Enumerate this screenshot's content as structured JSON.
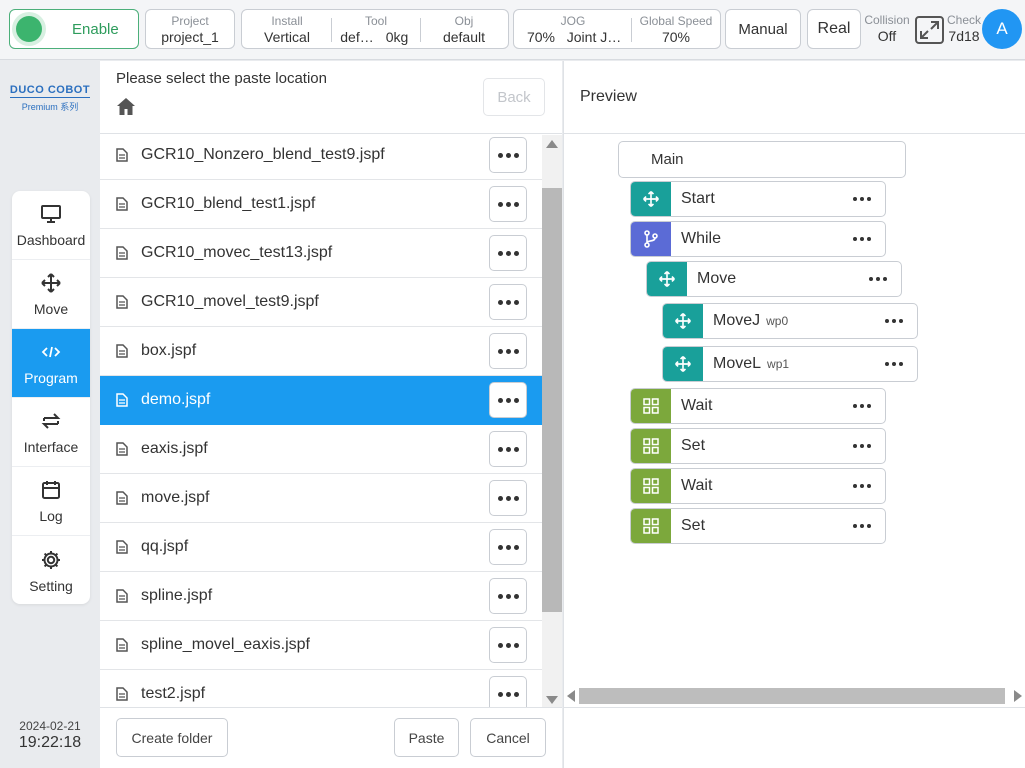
{
  "topbar": {
    "enable_label": "Enable",
    "project": {
      "caption": "Project",
      "value": "project_1"
    },
    "install": {
      "caption": "Install",
      "value": "Vertical"
    },
    "tool": {
      "caption": "Tool",
      "name": "def…",
      "weight": "0kg"
    },
    "obj": {
      "caption": "Obj",
      "value": "default"
    },
    "jog": {
      "caption": "JOG",
      "percent": "70%",
      "mode": "Joint J…"
    },
    "global_speed": {
      "caption": "Global Speed",
      "value": "70%"
    },
    "manual_label": "Manual",
    "real_label": "Real",
    "collision": {
      "caption": "Collision",
      "value": "Off"
    },
    "check": {
      "caption": "Check",
      "value": "7d18"
    },
    "avatar_letter": "A",
    "colors": {
      "enable_green": "#3cb46e",
      "accent_blue": "#1a9bf0",
      "avatar_blue": "#2196f3"
    }
  },
  "brand": {
    "line1": "DUCO COBOT",
    "line2": "Premium 系列"
  },
  "nav": {
    "items": [
      {
        "label": "Dashboard",
        "icon": "monitor-icon"
      },
      {
        "label": "Move",
        "icon": "move-arrows-icon"
      },
      {
        "label": "Program",
        "icon": "code-icon",
        "active": true
      },
      {
        "label": "Interface",
        "icon": "swap-icon"
      },
      {
        "label": "Log",
        "icon": "calendar-icon"
      },
      {
        "label": "Setting",
        "icon": "gear-icon"
      }
    ]
  },
  "datetime": {
    "date": "2024-02-21",
    "time": "19:22:18"
  },
  "filepanel": {
    "title": "Please select the paste location",
    "back_label": "Back",
    "files": [
      "GCR10_Nonzero_blend_test9.jspf",
      "GCR10_blend_test1.jspf",
      "GCR10_movec_test13.jspf",
      "GCR10_movel_test9.jspf",
      "box.jspf",
      "demo.jspf",
      "eaxis.jspf",
      "move.jspf",
      "qq.jspf",
      "spline.jspf",
      "spline_movel_eaxis.jspf",
      "test2.jspf"
    ],
    "selected": "demo.jspf",
    "footer": {
      "create_folder": "Create folder",
      "paste": "Paste",
      "cancel": "Cancel"
    }
  },
  "preview": {
    "title": "Preview",
    "main_label": "Main",
    "nodes": [
      {
        "label": "Start",
        "icon": "move-arrows-icon",
        "color": "#19a09a"
      },
      {
        "label": "While",
        "icon": "branch-icon",
        "color": "#5b6bd6"
      },
      {
        "label": "Move",
        "icon": "move-arrows-icon",
        "color": "#19a09a"
      },
      {
        "label": "MoveJ",
        "sub": "wp0",
        "icon": "move-arrows-icon",
        "color": "#19a09a"
      },
      {
        "label": "MoveL",
        "sub": "wp1",
        "icon": "move-arrows-icon",
        "color": "#19a09a"
      },
      {
        "label": "Wait",
        "icon": "grid-icon",
        "color": "#7ca83c"
      },
      {
        "label": "Set",
        "icon": "grid-icon",
        "color": "#7ca83c"
      },
      {
        "label": "Wait",
        "icon": "grid-icon",
        "color": "#7ca83c"
      },
      {
        "label": "Set",
        "icon": "grid-icon",
        "color": "#7ca83c"
      }
    ]
  }
}
